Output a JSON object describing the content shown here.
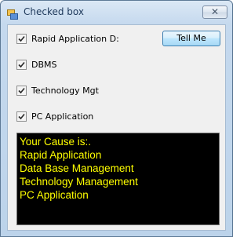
{
  "window": {
    "title": "Checked box",
    "close_glyph": "✕",
    "app_icon": "windows-form-icon"
  },
  "checkboxes": [
    {
      "label": "Rapid Application D:",
      "checked": true
    },
    {
      "label": "DBMS",
      "checked": true
    },
    {
      "label": "Technology Mgt",
      "checked": true
    },
    {
      "label": "PC Application",
      "checked": true
    }
  ],
  "button": {
    "label": "Tell Me"
  },
  "output": {
    "lines": [
      "Your Cause is:.",
      "Rapid Application",
      "Data Base Management",
      "Technology Management",
      "PC Application"
    ]
  },
  "colors": {
    "output_background": "#000000",
    "output_text": "#ffff00",
    "client_background": "#f0f0f0"
  }
}
